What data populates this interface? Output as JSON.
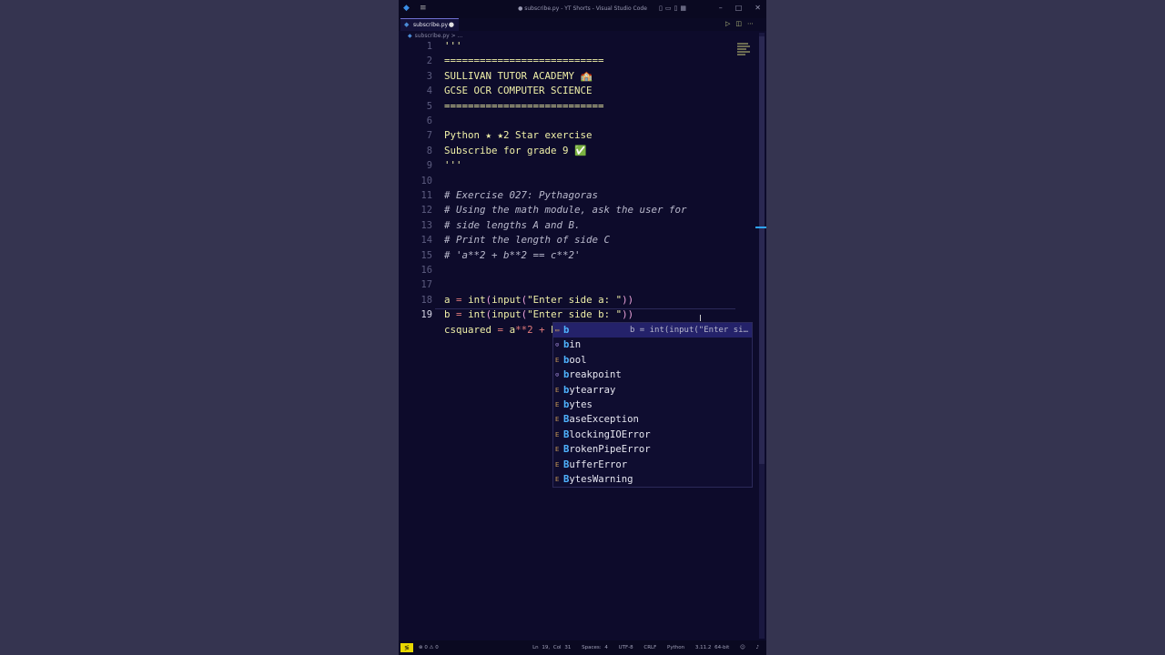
{
  "window": {
    "title": "● subscribe.py - YT Shorts - Visual Studio Code"
  },
  "tab": {
    "name": "subscribe.py"
  },
  "breadcrumb": {
    "file": "subscribe.py",
    "sep": ">",
    "more": "..."
  },
  "editor": {
    "lines": [
      {
        "n": "1",
        "text": "'''"
      },
      {
        "n": "2",
        "text": "==========================="
      },
      {
        "n": "3",
        "text": "SULLIVAN TUTOR ACADEMY 🏫"
      },
      {
        "n": "4",
        "text": "GCSE OCR COMPUTER SCIENCE"
      },
      {
        "n": "5",
        "text": "==========================="
      },
      {
        "n": "6",
        "text": ""
      },
      {
        "n": "7",
        "text": "Python ★ ★2 Star exercise"
      },
      {
        "n": "8",
        "text": "Subscribe for grade 9 ✅"
      },
      {
        "n": "9",
        "text": "'''"
      },
      {
        "n": "10",
        "text": ""
      },
      {
        "n": "11",
        "text": "# Exercise 027: Pythagoras"
      },
      {
        "n": "12",
        "text": "# Using the math module, ask the user for"
      },
      {
        "n": "13",
        "text": "# side lengths A and B."
      },
      {
        "n": "14",
        "text": "# Print the length of side C"
      },
      {
        "n": "15",
        "text": "# 'a**2 + b**2 == c**2'"
      },
      {
        "n": "16",
        "text": ""
      },
      {
        "n": "17",
        "text": ""
      },
      {
        "n": "18",
        "text": ""
      },
      {
        "n": "19",
        "text": ""
      }
    ],
    "line17": {
      "var": "a",
      "eq": "=",
      "fn": "int",
      "inner": "input",
      "str": "\"Enter side a: \""
    },
    "line18": {
      "var": "b",
      "eq": "=",
      "fn": "int",
      "inner": "input",
      "str": "\"Enter side b: \""
    },
    "line19": {
      "var": "csquared",
      "eq": "=",
      "a": "a",
      "pow": "**",
      "two": "2",
      "plus": "+",
      "b": "b"
    }
  },
  "suggestions": [
    {
      "m": "b",
      "rest": "",
      "detail": "b = int(input(\"Enter si…",
      "kind": "var"
    },
    {
      "m": "b",
      "rest": "in",
      "detail": "",
      "kind": "fn"
    },
    {
      "m": "b",
      "rest": "ool",
      "detail": "",
      "kind": "cls"
    },
    {
      "m": "b",
      "rest": "reakpoint",
      "detail": "",
      "kind": "fn"
    },
    {
      "m": "b",
      "rest": "ytearray",
      "detail": "",
      "kind": "cls"
    },
    {
      "m": "b",
      "rest": "ytes",
      "detail": "",
      "kind": "cls"
    },
    {
      "m": "B",
      "rest": "aseException",
      "detail": "",
      "kind": "cls"
    },
    {
      "m": "B",
      "rest": "lockingIOError",
      "detail": "",
      "kind": "cls"
    },
    {
      "m": "B",
      "rest": "rokenPipeError",
      "detail": "",
      "kind": "cls"
    },
    {
      "m": "B",
      "rest": "ufferError",
      "detail": "",
      "kind": "cls"
    },
    {
      "m": "B",
      "rest": "ytesWarning",
      "detail": "",
      "kind": "cls"
    }
  ],
  "statusbar": {
    "problems": "⊗ 0 ⚠ 0",
    "position": "Ln 19, Col 31",
    "spaces": "Spaces: 4",
    "encoding": "UTF-8",
    "eol": "CRLF",
    "language": "Python",
    "interpreter": "3.11.2 64-bit"
  },
  "colors": {
    "accent": "#4fb3ff",
    "background": "#0d0b2b",
    "code": "#f0f0a8",
    "remote": "#e8d800"
  }
}
